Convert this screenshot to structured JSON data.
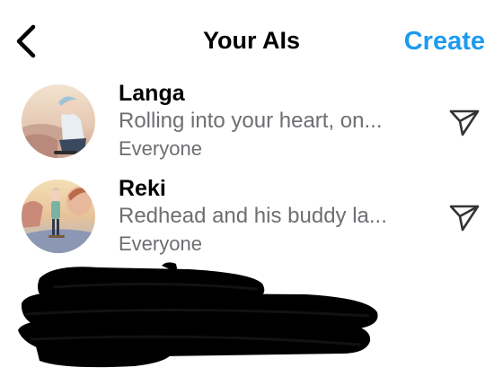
{
  "header": {
    "title": "Your AIs",
    "create_label": "Create",
    "back_icon": "chevron-left-icon"
  },
  "colors": {
    "accent": "#1d9bf0",
    "secondary_text": "#6e6e73",
    "primary_text": "#000000"
  },
  "ais": [
    {
      "name": "Langa",
      "preview": "Rolling into your heart, on...",
      "audience": "Everyone",
      "action_icon": "send-icon"
    },
    {
      "name": "Reki",
      "preview": "Redhead and his buddy la...",
      "audience": "Everyone",
      "action_icon": "send-icon"
    }
  ]
}
